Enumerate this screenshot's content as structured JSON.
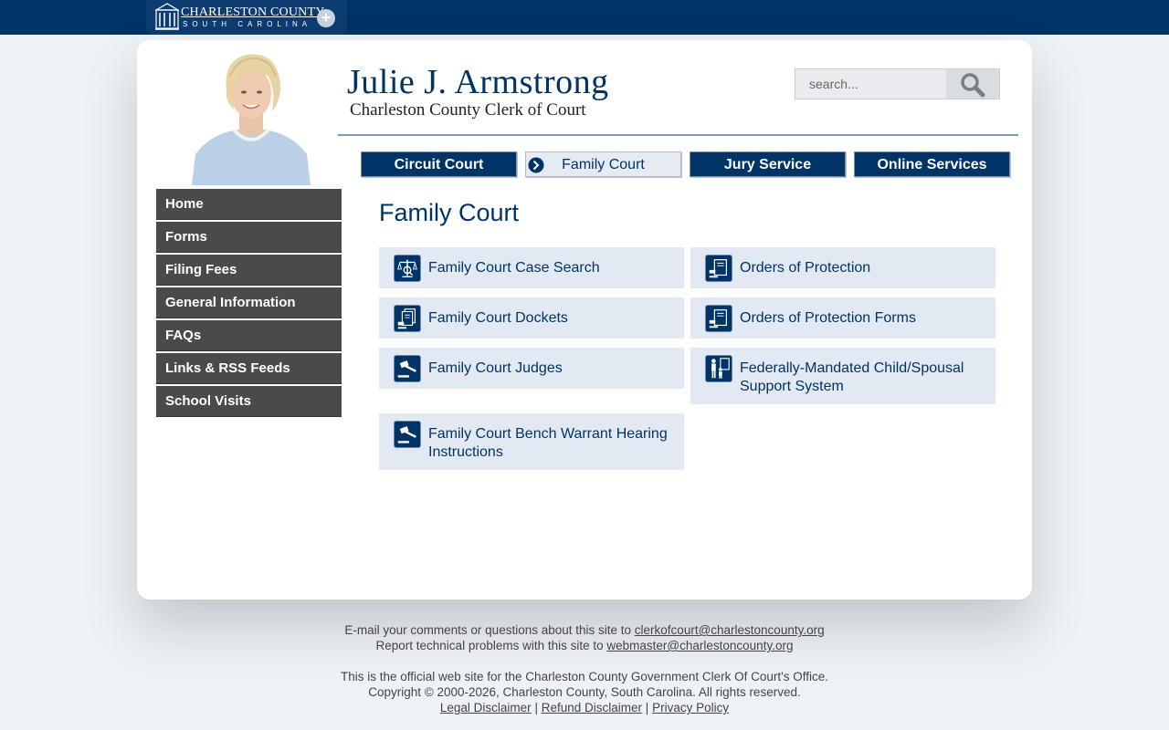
{
  "topbar": {
    "county_name": "CHARLESTON COUNTY",
    "county_state": "SOUTH CAROLINA",
    "building_icon": "county-building-icon",
    "plus_icon": "plus-icon"
  },
  "header": {
    "title": "Julie J. Armstrong",
    "subtitle": "Charleston County Clerk of Court"
  },
  "search": {
    "placeholder": "search..."
  },
  "tabs": [
    {
      "label": "Circuit Court",
      "active": false
    },
    {
      "label": "Family Court",
      "active": true
    },
    {
      "label": "Jury Service",
      "active": false
    },
    {
      "label": "Online Services",
      "active": false
    }
  ],
  "sidebar": {
    "items": [
      {
        "label": "Home"
      },
      {
        "label": "Forms"
      },
      {
        "label": "Filing Fees"
      },
      {
        "label": "General Information"
      },
      {
        "label": "FAQs"
      },
      {
        "label": "Links & RSS Feeds"
      },
      {
        "label": "School Visits"
      }
    ]
  },
  "main": {
    "title": "Family Court",
    "tiles": [
      {
        "label": "Family Court Case Search",
        "icon": "scales-search-icon"
      },
      {
        "label": "Orders of Protection",
        "icon": "document-gavel-icon"
      },
      {
        "label": "Family Court Dockets",
        "icon": "documents-stack-icon"
      },
      {
        "label": "Orders of Protection Forms",
        "icon": "document-gavel-icon"
      },
      {
        "label": "Family Court Judges",
        "icon": "gavel-icon"
      },
      {
        "label": "Federally-Mandated Child/Spousal Support System",
        "icon": "parent-child-icon"
      },
      {
        "label": "Family Court Bench Warrant Hearing Instructions",
        "icon": "gavel-icon"
      }
    ]
  },
  "footer": {
    "comments_text": "E-mail your comments or questions about this site to",
    "comments_email": "clerkofcourt@charlestoncounty.org",
    "problems_text": "Report technical problems with this site to",
    "problems_email": "webmaster@charlestoncounty.org",
    "official_text": "This is the official web site for the Charleston County Government Clerk Of Court's Office.",
    "copyright": "Copyright © 2000-2026, Charleston County, South Carolina. All rights reserved.",
    "links": [
      "Legal Disclaimer",
      "Refund Disclaimer",
      "Privacy Policy"
    ],
    "separator": "|"
  },
  "colors": {
    "brand": "#003366",
    "tile_bg": "#e3e9f2",
    "sidebar_bg": "#4a4a4a",
    "page_bg": "#eef2f6"
  }
}
